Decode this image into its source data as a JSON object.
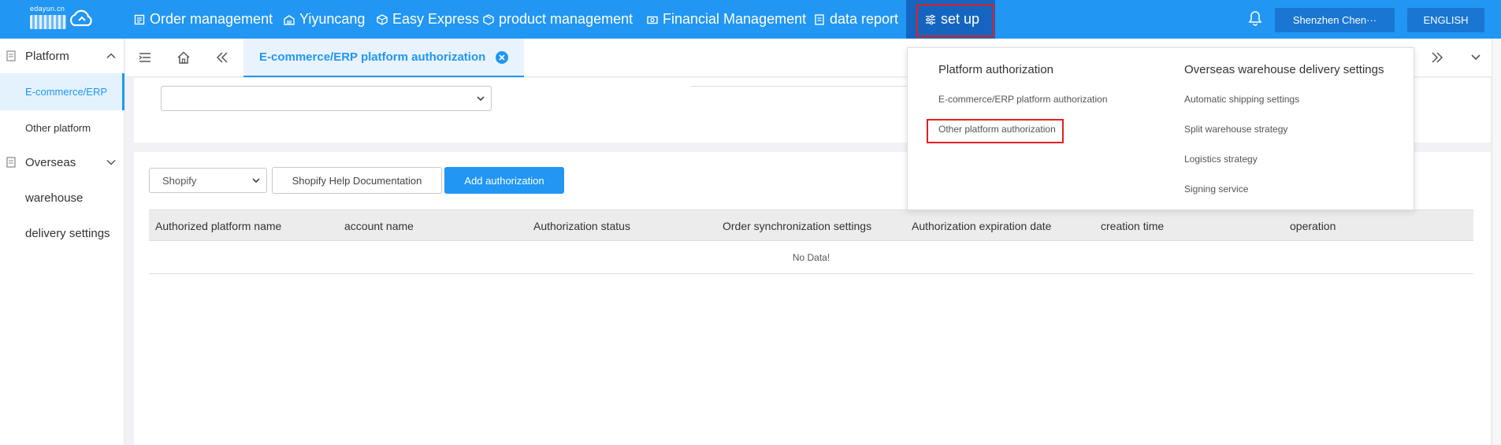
{
  "header": {
    "logo_text": "edayun.cn",
    "nav": [
      {
        "label": "Order management",
        "icon": "list-icon"
      },
      {
        "label": "Yiyuncang",
        "icon": "warehouse-icon"
      },
      {
        "label": "Easy Express",
        "icon": "package-icon"
      },
      {
        "label": "product management",
        "icon": "box-icon"
      },
      {
        "label": "Financial Management",
        "icon": "money-icon"
      },
      {
        "label": "data report",
        "icon": "report-icon"
      },
      {
        "label": "set up",
        "icon": "settings-sliders-icon"
      }
    ],
    "user": "Shenzhen Chen···",
    "language": "ENGLISH"
  },
  "sidebar": {
    "groups": [
      {
        "label": "Platform",
        "items": [
          "E-commerce/ERP",
          "Other platform"
        ]
      },
      {
        "label": "Overseas",
        "items": [
          "warehouse",
          "delivery settings"
        ]
      }
    ]
  },
  "tabs": {
    "active": "E-commerce/ERP platform authorization"
  },
  "toolbar": {
    "platform_value": "Shopify",
    "help_label": "Shopify Help Documentation",
    "add_label": "Add authorization"
  },
  "table": {
    "columns": [
      "Authorized platform name",
      "account name",
      "Authorization status",
      "Order synchronization settings",
      "Authorization expiration date",
      "creation time",
      "operation"
    ],
    "empty_text": "No Data!"
  },
  "dropdown": {
    "col1": {
      "title": "Platform authorization",
      "links": [
        "E-commerce/ERP platform authorization",
        "Other platform authorization"
      ]
    },
    "col2": {
      "title": "Overseas warehouse delivery settings",
      "links": [
        "Automatic shipping settings",
        "Split warehouse strategy",
        "Logistics strategy",
        "Signing service"
      ]
    }
  },
  "colors": {
    "primary": "#2196f3",
    "highlight_box": "#e02020"
  }
}
